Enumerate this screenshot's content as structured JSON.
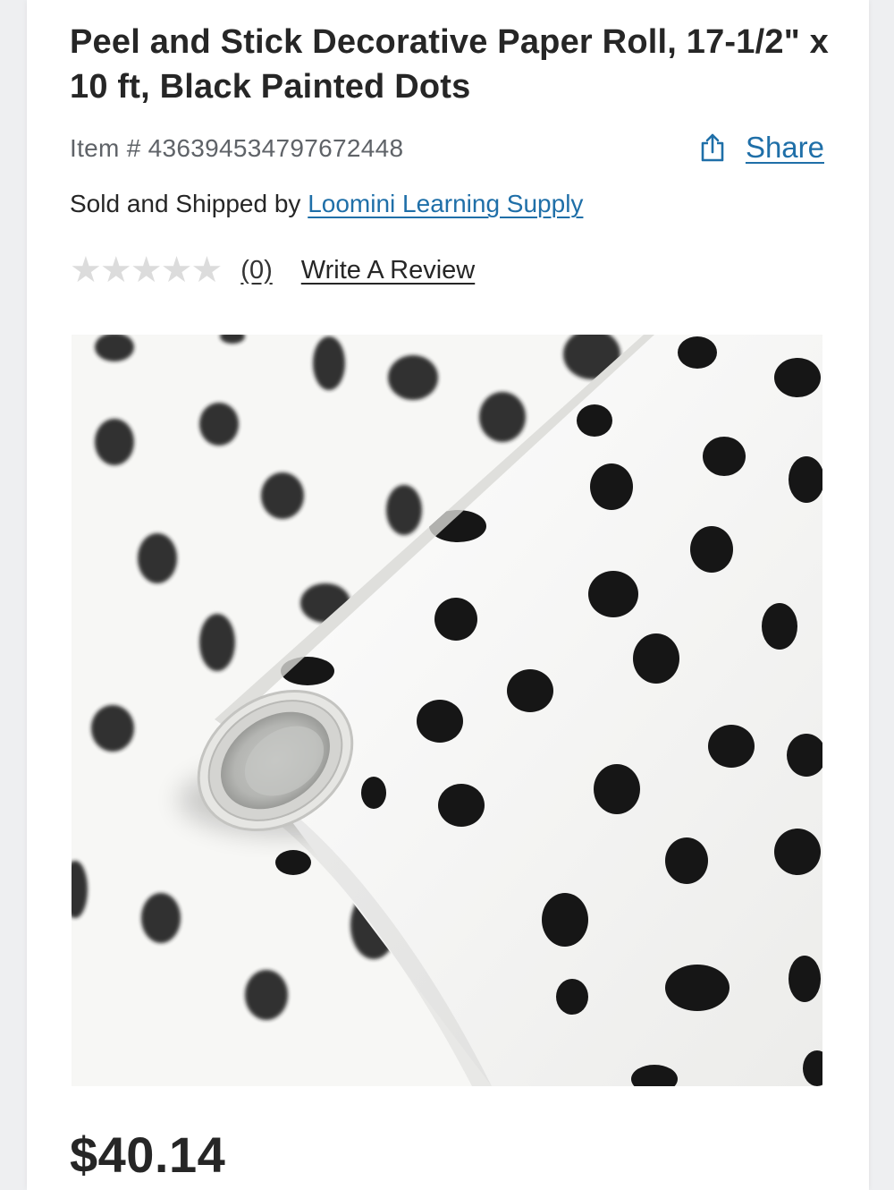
{
  "product": {
    "title": "Peel and Stick Decorative Paper Roll, 17-1/2\" x 10 ft, Black Painted Dots",
    "item_number": "Item # 436394534797672448",
    "share_label": "Share",
    "sold_by_prefix": "Sold and Shipped by ",
    "seller_name": "Loomini Learning Supply",
    "rating": {
      "stars": "★★★★★",
      "stars_filled": 0,
      "stars_max": 5,
      "review_count": "(0)",
      "write_review_label": "Write A Review"
    },
    "image_icon": "polka-dot-paper-roll-image",
    "price": "$40.14"
  },
  "colors": {
    "link": "#1f6fa8",
    "text": "#262626",
    "muted": "#5f6368",
    "star_empty": "#dcdcdc"
  }
}
